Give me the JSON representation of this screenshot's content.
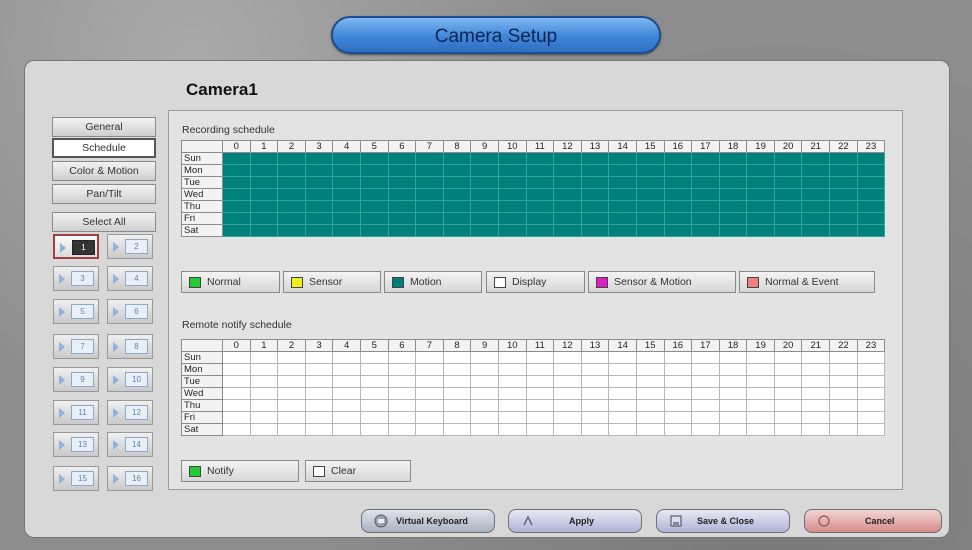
{
  "header": {
    "title": "Camera Setup"
  },
  "camera_title": "Camera1",
  "nav": {
    "tabs": [
      "General",
      "Schedule",
      "Color & Motion",
      "Pan/Tilt"
    ],
    "active_tab": "Schedule",
    "select_all": "Select All",
    "cameras": [
      "1",
      "2",
      "3",
      "4",
      "5",
      "6",
      "7",
      "8",
      "9",
      "10",
      "11",
      "12",
      "13",
      "14",
      "15",
      "16"
    ],
    "active_camera": "1"
  },
  "recording": {
    "label": "Recording schedule",
    "hours": [
      "0",
      "1",
      "2",
      "3",
      "4",
      "5",
      "6",
      "7",
      "8",
      "9",
      "10",
      "11",
      "12",
      "13",
      "14",
      "15",
      "16",
      "17",
      "18",
      "19",
      "20",
      "21",
      "22",
      "23"
    ],
    "days": [
      "Sun",
      "Mon",
      "Tue",
      "Wed",
      "Thu",
      "Fri",
      "Sat"
    ],
    "cell_state": "Motion"
  },
  "legend": [
    {
      "label": "Normal",
      "color": "#22cc33"
    },
    {
      "label": "Sensor",
      "color": "#f0f020"
    },
    {
      "label": "Motion",
      "color": "#007f79"
    },
    {
      "label": "Display",
      "color": "#ffffff"
    },
    {
      "label": "Sensor & Motion",
      "color": "#e020c0"
    },
    {
      "label": "Normal & Event",
      "color": "#f08080"
    }
  ],
  "notify": {
    "label": "Remote notify schedule",
    "hours": [
      "0",
      "1",
      "2",
      "3",
      "4",
      "5",
      "6",
      "7",
      "8",
      "9",
      "10",
      "11",
      "12",
      "13",
      "14",
      "15",
      "16",
      "17",
      "18",
      "19",
      "20",
      "21",
      "22",
      "23"
    ],
    "days": [
      "Sun",
      "Mon",
      "Tue",
      "Wed",
      "Thu",
      "Fri",
      "Sat"
    ],
    "cell_state": "Clear",
    "legend": [
      {
        "label": "Notify",
        "color": "#22cc33"
      },
      {
        "label": "Clear",
        "color": "#ffffff"
      }
    ]
  },
  "footer": {
    "virtual_keyboard": "Virtual Keyboard",
    "apply": "Apply",
    "save_close": "Save & Close",
    "cancel": "Cancel"
  }
}
